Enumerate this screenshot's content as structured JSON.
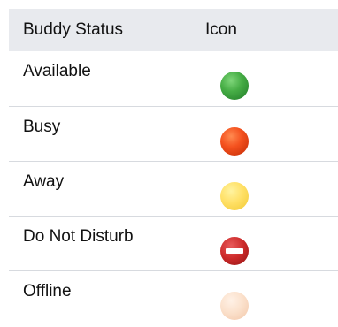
{
  "table": {
    "headers": {
      "status": "Buddy Status",
      "icon": "Icon"
    },
    "rows": [
      {
        "status": "Available",
        "icon": "available-green-dot-icon",
        "color": "#4caf50"
      },
      {
        "status": "Busy",
        "icon": "busy-red-dot-icon",
        "color": "#f4511e"
      },
      {
        "status": "Away",
        "icon": "away-yellow-dot-icon",
        "color": "#ffe066"
      },
      {
        "status": "Do Not Disturb",
        "icon": "do-not-disturb-icon",
        "color": "#d32f2f"
      },
      {
        "status": "Offline",
        "icon": "offline-peach-dot-icon",
        "color": "#fbe1cc"
      }
    ]
  }
}
